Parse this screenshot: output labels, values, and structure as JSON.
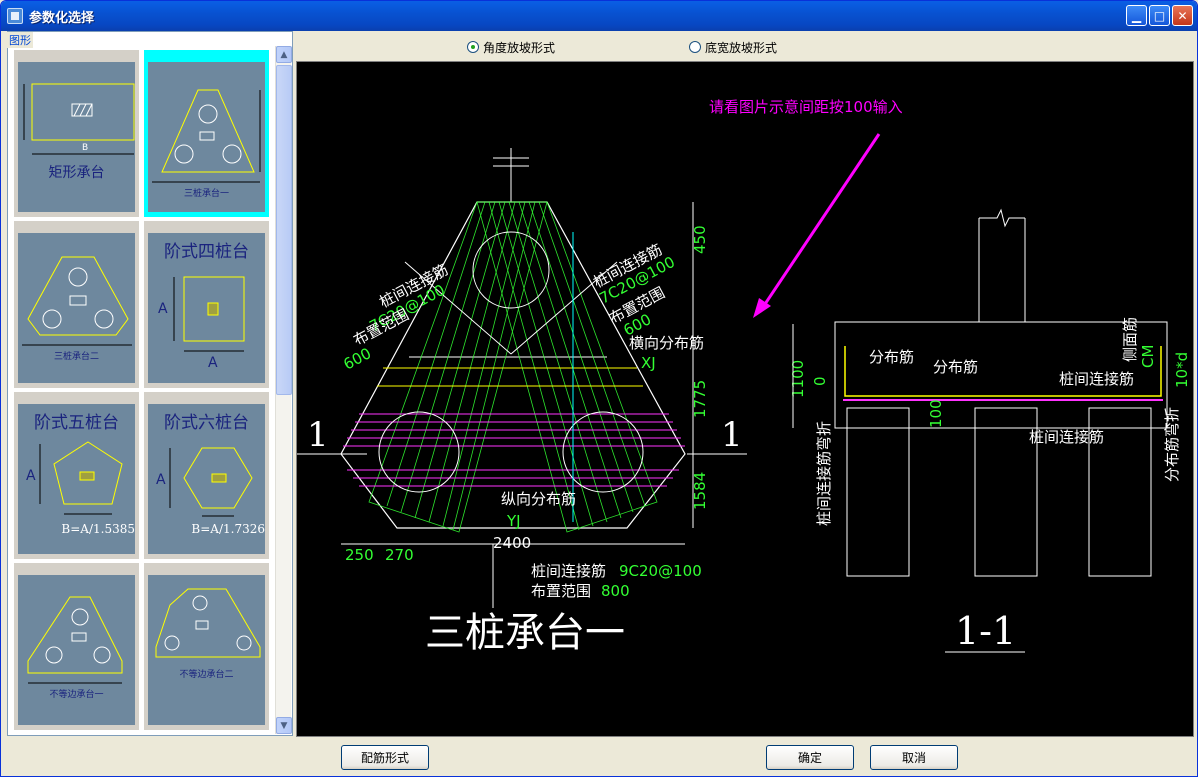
{
  "window": {
    "title": "参数化选择"
  },
  "sidebar": {
    "group_label": "图形",
    "items": [
      {
        "label": "矩形承台",
        "dim_b": "B"
      },
      {
        "label": "三桩承台一"
      },
      {
        "label": "三桩承台二"
      },
      {
        "label": "阶式四桩台",
        "dim_a1": "A",
        "dim_a2": "A"
      },
      {
        "label": "阶式五桩台",
        "dim_a": "A",
        "formula": "B=A/1.5385"
      },
      {
        "label": "阶式六桩台",
        "dim_a": "A",
        "formula": "B=A/1.7326"
      },
      {
        "label": "不等边承台一"
      },
      {
        "label": "不等边承台二"
      }
    ]
  },
  "options": {
    "angle_label": "角度放坡形式",
    "width_label": "底宽放坡形式",
    "selected": "angle"
  },
  "drawing": {
    "hint": "请看图片示意间距按100输入",
    "main_title": "三桩承台一",
    "section_title": "1-1",
    "section_mark": "1",
    "rebar_left": "桩间连接筋",
    "rebar_left_spec": "7C20@100",
    "range_left": "布置范围",
    "range_left_val": "600",
    "rebar_right": "桩间连接筋",
    "rebar_right_spec": "7C20@100",
    "range_right": "布置范围",
    "range_right_val": "600",
    "transverse": "横向分布筋",
    "xj": "XJ",
    "longitudinal": "纵向分布筋",
    "yj": "YJ",
    "rebar_bottom": "桩间连接筋",
    "rebar_bottom_spec": "9C20@100",
    "range_bottom": "布置范围",
    "range_bottom_val": "800",
    "dim_450": "450",
    "dim_1775": "1775",
    "dim_1584": "1584",
    "dim_250": "250",
    "dim_270": "270",
    "dim_2400": "2400",
    "sec_dim_1100": "1100",
    "sec_dim_0": "0",
    "sec_dim_100": "100",
    "sec_dist1": "分布筋",
    "sec_dist2": "分布筋",
    "sec_side": "侧面筋",
    "sec_cm": "CM",
    "sec_link": "桩间连接筋",
    "sec_link2": "桩间连接筋",
    "sec_bend": "桩间连接筋弯折",
    "sec_dist_bend": "分布筋弯折",
    "sec_10d": "10*d"
  },
  "buttons": {
    "rebar_form": "配筋形式",
    "ok": "确定",
    "cancel": "取消"
  }
}
